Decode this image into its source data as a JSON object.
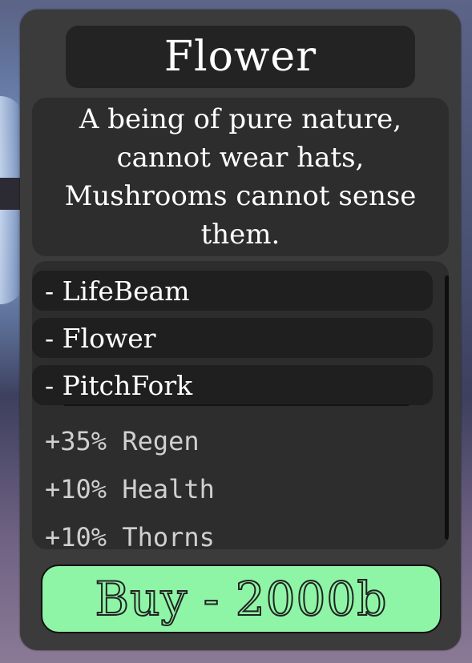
{
  "shop_item": {
    "title": "Flower",
    "description": "A being of pure nature,\ncannot wear hats,\nMushrooms cannot sense\nthem.",
    "abilities": [
      {
        "label": "- LifeBeam"
      },
      {
        "label": "- Flower"
      },
      {
        "label": "- PitchFork"
      }
    ],
    "stats": [
      {
        "text": "+35% Regen"
      },
      {
        "text": "+10% Health"
      },
      {
        "text": "+10% Thorns"
      }
    ],
    "buy_button": {
      "label": "Buy - 2000b",
      "color": "#8ef5a6"
    }
  },
  "theme": {
    "panel_color": "#3b3b3b",
    "box_color": "#2d2d2d",
    "row_color": "#1f1f1f"
  }
}
